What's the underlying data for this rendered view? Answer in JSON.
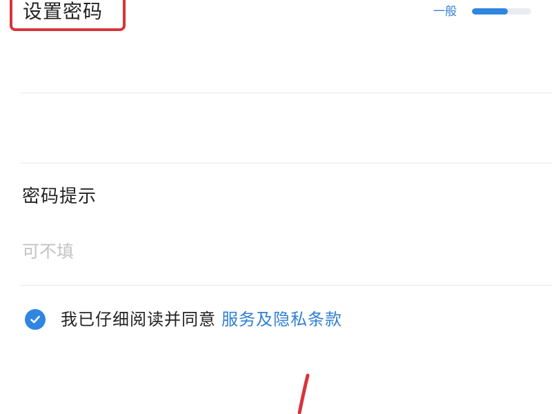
{
  "form": {
    "title": "设置密码",
    "strength_label": "一般",
    "strength_level": 0.6,
    "hint_label": "密码提示",
    "hint_placeholder": "可不填",
    "agree_text": "我已仔细阅读并同意",
    "agree_link": "服务及隐私条款",
    "agree_checked": true
  },
  "colors": {
    "accent": "#2f86e0",
    "annotation": "#d8343a"
  }
}
